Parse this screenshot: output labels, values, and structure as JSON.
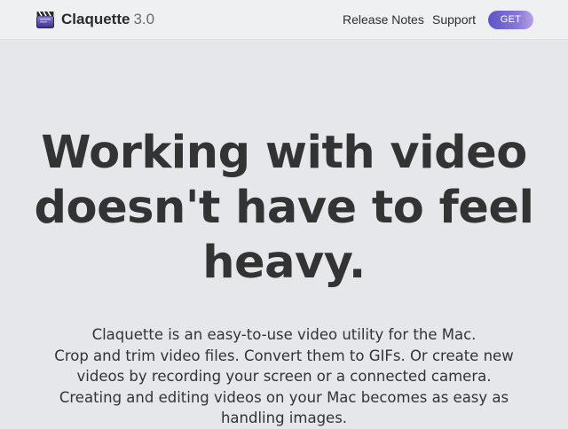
{
  "app": {
    "name": "Claquette",
    "version": "3.0"
  },
  "nav": {
    "release_notes": "Release Notes",
    "support": "Support",
    "get": "GET"
  },
  "hero": {
    "title_lines": [
      "Working with video",
      "doesn't have to feel",
      "heavy."
    ],
    "body_lines": [
      "Claquette is an easy-to-use video utility for the Mac.",
      "Crop and trim video files. Convert them to GIFs. Or create new",
      "videos by recording your screen or a connected camera.",
      "Creating and editing videos on your Mac becomes as easy as",
      "handling images."
    ]
  },
  "colors": {
    "page_background": "#e5e7ea",
    "navbar_background": "#eef0f2",
    "text": "#333333",
    "get_button_start": "#5a55c9",
    "get_button_end": "#b7a1e6"
  },
  "icons": {
    "brand": "clapperboard-icon"
  }
}
